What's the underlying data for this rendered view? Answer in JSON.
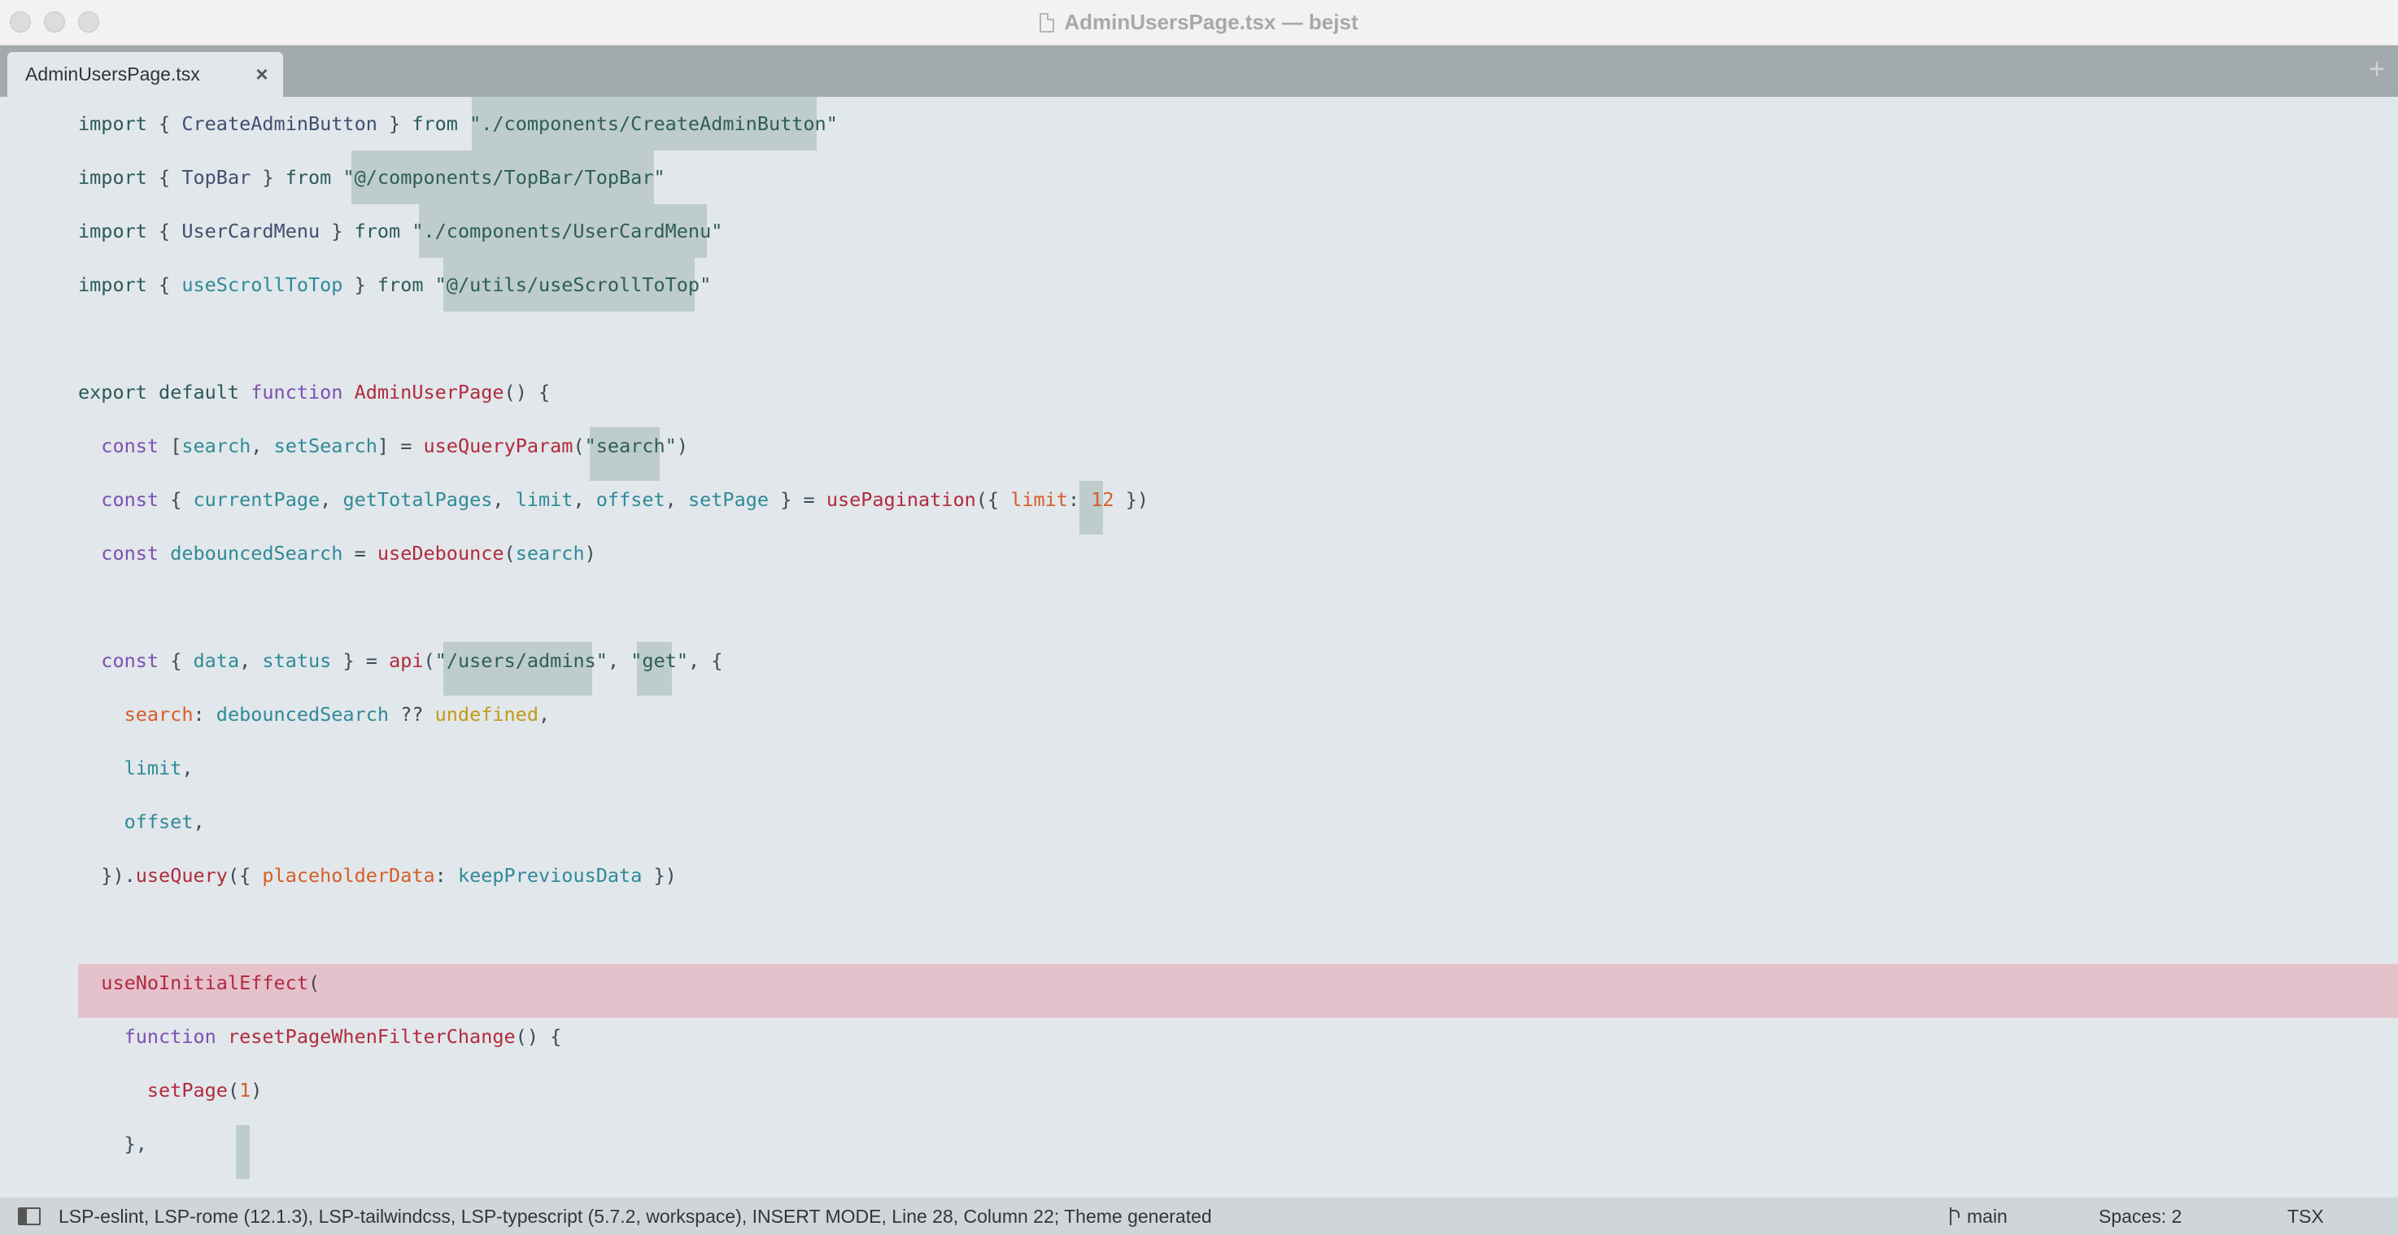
{
  "window": {
    "title": "AdminUsersPage.tsx — bejst"
  },
  "tabs": [
    {
      "label": "AdminUsersPage.tsx",
      "close_glyph": "×"
    }
  ],
  "tabbar": {
    "add_glyph": "+"
  },
  "editor": {
    "lines": [
      "import { CreateAdminButton } from \"./components/CreateAdminButton\"",
      "import { TopBar } from \"@/components/TopBar/TopBar\"",
      "import { UserCardMenu } from \"./components/UserCardMenu\"",
      "import { useScrollToTop } from \"@/utils/useScrollToTop\"",
      "",
      "export default function AdminUserPage() {",
      "  const [search, setSearch] = useQueryParam(\"search\")",
      "  const { currentPage, getTotalPages, limit, offset, setPage } = usePagination({ limit: 12 })",
      "  const debouncedSearch = useDebounce(search)",
      "",
      "  const { data, status } = api(\"/users/admins\", \"get\", {",
      "    search: debouncedSearch ?? undefined,",
      "    limit,",
      "    offset,",
      "  }).useQuery({ placeholderData: keepPreviousData })",
      "",
      "  useNoInitialEffect(",
      "    function resetPageWhenFilterChange() {",
      "      setPage(1)",
      "    },"
    ],
    "highlighted_line_index": 16,
    "colors": {
      "background": "#e1e7ea",
      "current_line": "#e5c1cc",
      "selection": "#becccc"
    }
  },
  "statusbar": {
    "text": "LSP-eslint, LSP-rome (12.1.3), LSP-tailwindcss, LSP-typescript (5.7.2, workspace), INSERT MODE, Line 28, Column 22; Theme generated",
    "branch": "main",
    "spaces": "Spaces: 2",
    "syntax": "TSX"
  }
}
